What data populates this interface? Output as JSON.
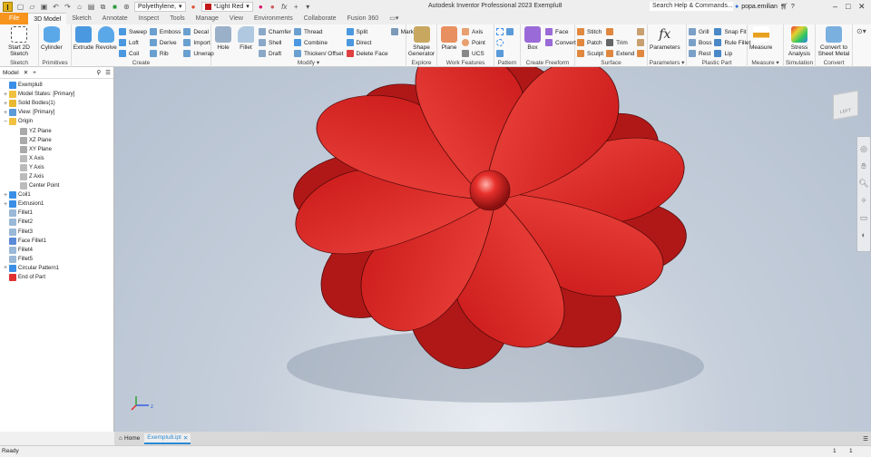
{
  "titlebar": {
    "logo": "I",
    "material": "Polyethylene,",
    "appearance": "*Light Red",
    "title": "Autodesk Inventor Professional 2023   Exemplu8",
    "search_placeholder": "Search Help & Commands...",
    "user": "popa.emilian"
  },
  "tabs": [
    "File",
    "3D Model",
    "Sketch",
    "Annotate",
    "Inspect",
    "Tools",
    "Manage",
    "View",
    "Environments",
    "Collaborate",
    "Fusion 360"
  ],
  "ribbon": {
    "sketch": {
      "label": "Sketch",
      "start": "Start 2D Sketch"
    },
    "primitives": {
      "label": "Primitives",
      "cylinder": "Cylinder"
    },
    "create": {
      "label": "Create",
      "extrude": "Extrude",
      "revolve": "Revolve",
      "items": [
        "Sweep",
        "Loft",
        "Coil",
        "Emboss",
        "Derive",
        "Rib",
        "Decal",
        "Import",
        "Unwrap"
      ]
    },
    "modify": {
      "label": "Modify",
      "hole": "Hole",
      "fillet": "Fillet",
      "items": [
        "Chamfer",
        "Shell",
        "Draft",
        "Thread",
        "Combine",
        "Thicken/ Offset",
        "Split",
        "Direct",
        "Delete Face",
        "Mark"
      ]
    },
    "explore": {
      "label": "Explore",
      "shape": "Shape Generator"
    },
    "work": {
      "label": "Work Features",
      "plane": "Plane",
      "items": [
        "Axis",
        "Point",
        "UCS"
      ]
    },
    "pattern": {
      "label": "Pattern"
    },
    "freeform": {
      "label": "Create Freeform",
      "box": "Box",
      "items": [
        "Face",
        "Convert"
      ]
    },
    "surface": {
      "label": "Surface",
      "items": [
        "Stitch",
        "Patch",
        "Sculpt",
        "Trim",
        "Extend"
      ]
    },
    "parameters": {
      "label": "Parameters",
      "btn": "Parameters",
      "icon": "fx"
    },
    "plastic": {
      "label": "Plastic Part",
      "items": [
        "Grill",
        "Boss",
        "Rest",
        "Snap Fit",
        "Rule Fillet",
        "Lip"
      ]
    },
    "measure": {
      "label": "Measure",
      "btn": "Measure"
    },
    "simulation": {
      "label": "Simulation",
      "btn": "Stress Analysis"
    },
    "convert": {
      "label": "Convert",
      "btn": "Convert to Sheet Metal"
    }
  },
  "browser": {
    "tab": "Model",
    "nodes": [
      {
        "label": "Exemplu8",
        "exp": "",
        "color": "#3a8ee6",
        "indent": 0
      },
      {
        "label": "Model States: [Primary]",
        "exp": "+",
        "color": "#f0c040",
        "indent": 0
      },
      {
        "label": "Solid Bodies(1)",
        "exp": "+",
        "color": "#e8b830",
        "indent": 0
      },
      {
        "label": "View: [Primary]",
        "exp": "+",
        "color": "#5a9ad8",
        "indent": 0
      },
      {
        "label": "Origin",
        "exp": "−",
        "color": "#f0c040",
        "indent": 0
      },
      {
        "label": "YZ Plane",
        "exp": "",
        "color": "#aaa",
        "indent": 1
      },
      {
        "label": "XZ Plane",
        "exp": "",
        "color": "#aaa",
        "indent": 1
      },
      {
        "label": "XY Plane",
        "exp": "",
        "color": "#aaa",
        "indent": 1
      },
      {
        "label": "X Axis",
        "exp": "",
        "color": "#bbb",
        "indent": 1
      },
      {
        "label": "Y Axis",
        "exp": "",
        "color": "#bbb",
        "indent": 1
      },
      {
        "label": "Z Axis",
        "exp": "",
        "color": "#bbb",
        "indent": 1
      },
      {
        "label": "Center Point",
        "exp": "",
        "color": "#bbb",
        "indent": 1
      },
      {
        "label": "Coil1",
        "exp": "+",
        "color": "#3a8ee6",
        "indent": 0
      },
      {
        "label": "Extrusion1",
        "exp": "+",
        "color": "#3a8ee6",
        "indent": 0
      },
      {
        "label": "Fillet1",
        "exp": "",
        "color": "#9ab8d8",
        "indent": 0
      },
      {
        "label": "Fillet2",
        "exp": "",
        "color": "#9ab8d8",
        "indent": 0
      },
      {
        "label": "Fillet3",
        "exp": "",
        "color": "#9ab8d8",
        "indent": 0
      },
      {
        "label": "Face Fillet1",
        "exp": "",
        "color": "#5a8ad8",
        "indent": 0
      },
      {
        "label": "Fillet4",
        "exp": "",
        "color": "#9ab8d8",
        "indent": 0
      },
      {
        "label": "Fillet5",
        "exp": "",
        "color": "#9ab8d8",
        "indent": 0
      },
      {
        "label": "Circular Pattern1",
        "exp": "+",
        "color": "#3a8ee6",
        "indent": 0
      },
      {
        "label": "End of Part",
        "exp": "",
        "color": "#e03030",
        "indent": 0
      }
    ]
  },
  "viewcube": {
    "face": "LEFT"
  },
  "doctabs": {
    "home": "Home",
    "file": "Exemplu8.ipt"
  },
  "status": {
    "text": "Ready",
    "n1": "1",
    "n2": "1"
  },
  "colors": {
    "part": "#e8302c",
    "file_tab": "#f7941d",
    "accent": "#2a8ad4"
  }
}
